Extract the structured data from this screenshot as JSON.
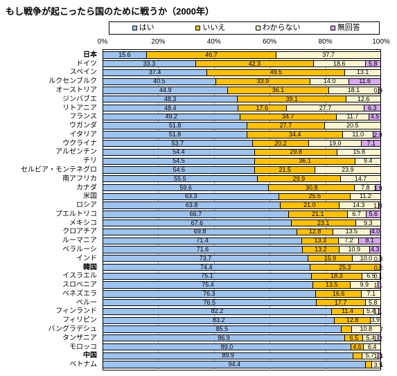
{
  "title": "もし戦争が起こったら国のために戦うか（2000年）",
  "legend": [
    {
      "label": "はい",
      "color": "#9DC3F0",
      "key": "yes"
    },
    {
      "label": "いいえ",
      "color": "#FFC000",
      "key": "no"
    },
    {
      "label": "わからない",
      "color": "#FAF5CE",
      "key": "unknown"
    },
    {
      "label": "無回答",
      "color": "#D9A9EE",
      "key": "na"
    }
  ],
  "axis": {
    "ticks": [
      "0%",
      "20%",
      "40%",
      "60%",
      "80%",
      "100%"
    ],
    "values": [
      0,
      20,
      40,
      60,
      80,
      100
    ],
    "min": 0,
    "max": 100
  },
  "chart_data": {
    "type": "bar",
    "orientation": "horizontal",
    "stacked": true,
    "title": "もし戦争が起こったら国のために戦うか（2000年）",
    "xlabel": "",
    "ylabel": "",
    "xlim": [
      0,
      100
    ],
    "grid": true,
    "legend_position": "top",
    "series": [
      {
        "name": "はい",
        "color": "#9DC3F0"
      },
      {
        "name": "いいえ",
        "color": "#FFC000"
      },
      {
        "name": "わからない",
        "color": "#FAF5CE"
      },
      {
        "name": "無回答",
        "color": "#D9A9EE"
      }
    ],
    "categories": [
      "日本",
      "ドイツ",
      "スペイン",
      "ルクセンブルク",
      "オーストリア",
      "ジンバブエ",
      "リトアニア",
      "フランス",
      "ウガンダ",
      "イタリア",
      "ウクライナ",
      "アルゼンチン",
      "チリ",
      "セルビア・モンテネグロ",
      "南アフリカ",
      "カナダ",
      "米国",
      "ロシア",
      "プエルトリコ",
      "メキシコ",
      "クロアチア",
      "ルーマニア",
      "ベラルーシ",
      "インド",
      "韓国",
      "イスラエル",
      "スロベニア",
      "ベネズエラ",
      "ペルー",
      "フィンランド",
      "フィリピン",
      "バングラデシュ",
      "タンザニア",
      "モロッコ",
      "中国",
      "ベトナム"
    ],
    "rows": [
      {
        "country": "日本",
        "emph": true,
        "yes": 15.6,
        "no": 46.7,
        "unknown": 37.7,
        "na": 0.0
      },
      {
        "country": "ドイツ",
        "emph": false,
        "yes": 33.3,
        "no": 42.3,
        "unknown": 18.6,
        "na": 5.8
      },
      {
        "country": "スペイン",
        "emph": false,
        "yes": 37.4,
        "no": 49.5,
        "unknown": 13.1,
        "na": 0.0
      },
      {
        "country": "ルクセンブルク",
        "emph": false,
        "yes": 40.5,
        "no": 33.9,
        "unknown": 14.0,
        "na": 11.6
      },
      {
        "country": "オーストリア",
        "emph": false,
        "yes": 44.9,
        "no": 36.1,
        "unknown": 18.1,
        "na": 0.9
      },
      {
        "country": "ジンバブエ",
        "emph": false,
        "yes": 48.3,
        "no": 39.1,
        "unknown": 12.6,
        "na": 0.0
      },
      {
        "country": "リトアニア",
        "emph": false,
        "yes": 48.4,
        "no": 17.6,
        "unknown": 27.7,
        "na": 6.3
      },
      {
        "country": "フランス",
        "emph": false,
        "yes": 49.2,
        "no": 34.7,
        "unknown": 11.7,
        "na": 4.5
      },
      {
        "country": "ウガンダ",
        "emph": false,
        "yes": 51.8,
        "no": 27.7,
        "unknown": 20.5,
        "na": 0.0
      },
      {
        "country": "イタリア",
        "emph": false,
        "yes": 51.8,
        "no": 34.4,
        "unknown": 11.0,
        "na": 2.9
      },
      {
        "country": "ウクライナ",
        "emph": false,
        "yes": 53.7,
        "no": 20.2,
        "unknown": 19.0,
        "na": 7.1
      },
      {
        "country": "アルゼンチン",
        "emph": false,
        "yes": 54.4,
        "no": 29.8,
        "unknown": 15.8,
        "na": 0.0
      },
      {
        "country": "チリ",
        "emph": false,
        "yes": 54.5,
        "no": 36.1,
        "unknown": 9.4,
        "na": 0.0
      },
      {
        "country": "セルビア・モンテネグロ",
        "emph": false,
        "yes": 54.6,
        "no": 21.5,
        "unknown": 23.9,
        "na": 0.0
      },
      {
        "country": "南アフリカ",
        "emph": false,
        "yes": 55.5,
        "no": 29.9,
        "unknown": 14.7,
        "na": 0.0
      },
      {
        "country": "カナダ",
        "emph": false,
        "yes": 59.6,
        "no": 30.8,
        "unknown": 7.8,
        "na": 1.9
      },
      {
        "country": "米国",
        "emph": false,
        "yes": 63.3,
        "no": 25.5,
        "unknown": 11.2,
        "na": 0.0
      },
      {
        "country": "ロシア",
        "emph": false,
        "yes": 63.8,
        "no": 21.0,
        "unknown": 14.3,
        "na": 1.0
      },
      {
        "country": "プエルトリコ",
        "emph": false,
        "yes": 66.7,
        "no": 21.1,
        "unknown": 6.7,
        "na": 5.6
      },
      {
        "country": "メキシコ",
        "emph": false,
        "yes": 67.6,
        "no": 23.1,
        "unknown": 9.3,
        "na": 0.0
      },
      {
        "country": "クロアチア",
        "emph": false,
        "yes": 69.8,
        "no": 12.8,
        "unknown": 13.5,
        "na": 4.0
      },
      {
        "country": "ルーマニア",
        "emph": false,
        "yes": 71.4,
        "no": 13.3,
        "unknown": 7.2,
        "na": 8.1
      },
      {
        "country": "ベラルーシ",
        "emph": false,
        "yes": 71.6,
        "no": 13.2,
        "unknown": 10.9,
        "na": 4.3
      },
      {
        "country": "インド",
        "emph": false,
        "yes": 73.7,
        "no": 15.9,
        "unknown": 10.0,
        "na": 0.3
      },
      {
        "country": "韓国",
        "emph": true,
        "yes": 74.4,
        "no": 25.3,
        "unknown": 0.2,
        "na": 0.0
      },
      {
        "country": "イスラエル",
        "emph": false,
        "yes": 75.1,
        "no": 18.3,
        "unknown": 6.5,
        "na": 0.1
      },
      {
        "country": "スロベニア",
        "emph": false,
        "yes": 75.4,
        "no": 13.5,
        "unknown": 9.9,
        "na": 1.1
      },
      {
        "country": "ベネズエラ",
        "emph": false,
        "yes": 76.3,
        "no": 16.6,
        "unknown": 7.1,
        "na": 0.0
      },
      {
        "country": "ペルー",
        "emph": false,
        "yes": 76.5,
        "no": 17.7,
        "unknown": 5.8,
        "na": 0.0
      },
      {
        "country": "フィンランド",
        "emph": false,
        "yes": 82.2,
        "no": 11.4,
        "unknown": 5.4,
        "na": 1.1
      },
      {
        "country": "フィリピン",
        "emph": false,
        "yes": 83.2,
        "no": 12.8,
        "unknown": 3.9,
        "na": 0.0
      },
      {
        "country": "バングラデシュ",
        "emph": false,
        "yes": 85.5,
        "no": 3.7,
        "unknown": 10.8,
        "na": 0.0
      },
      {
        "country": "タンザニア",
        "emph": false,
        "yes": 86.9,
        "no": 6.5,
        "unknown": 5.4,
        "na": 1.2
      },
      {
        "country": "モロッコ",
        "emph": false,
        "yes": 89.0,
        "no": 4.6,
        "unknown": 6.4,
        "na": 0.0
      },
      {
        "country": "中国",
        "emph": true,
        "yes": 89.9,
        "no": 3.1,
        "unknown": 5.7,
        "na": 1.3
      },
      {
        "country": "ベトナム",
        "emph": false,
        "yes": 94.4,
        "no": 2.1,
        "unknown": 3.5,
        "na": 0.0
      }
    ]
  }
}
